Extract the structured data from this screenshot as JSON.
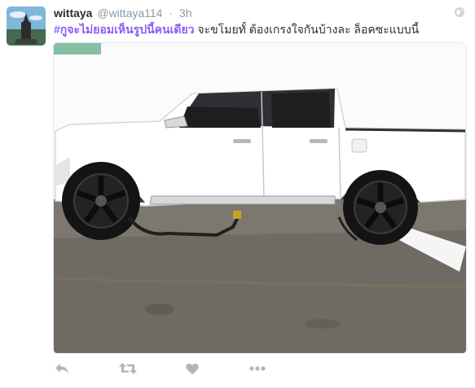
{
  "tweet": {
    "display_name": "wittaya",
    "handle": "@wittaya114",
    "separator": "·",
    "time": "3h",
    "hashtag": "#กูจะไม่ยอมเห็นรูปนี้คนเดียว",
    "body": " จะขโมยทั้ ต้องเกรงใจกันบ้างละ ล็อคซะแบบนี้"
  },
  "icons": {
    "avatar": "avatar",
    "globe": "globe-icon",
    "reply": "reply-icon",
    "retweet": "retweet-icon",
    "like": "heart-icon",
    "more": "more-icon"
  },
  "colors": {
    "hashtag": "#8a5cf7",
    "icon": "#aab8c2",
    "name": "#292f33",
    "meta": "#8899a6"
  }
}
